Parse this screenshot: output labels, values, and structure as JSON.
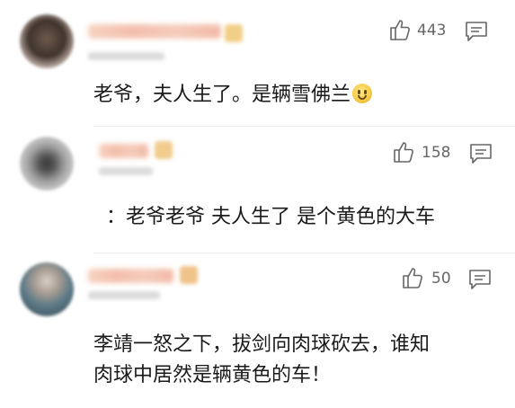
{
  "comments": [
    {
      "likes": "443",
      "text": "老爷，夫人生了。是辆雪佛兰"
    },
    {
      "likes": "158",
      "text": "：老爷老爷 夫人生了 是个黄色的大车"
    },
    {
      "likes": "50",
      "text_line1": "李靖一怒之下，拔剑向肉球砍去，谁知",
      "text_line2": "肉球中居然是辆黄色的车！"
    }
  ],
  "icons": {
    "like": "thumbs-up-outline",
    "reply": "speech-bubble-outline",
    "emoji": "laughing-face"
  },
  "colors": {
    "text": "#1a1a1a",
    "meta": "#666666",
    "divider": "#ececec",
    "background": "#ffffff"
  }
}
